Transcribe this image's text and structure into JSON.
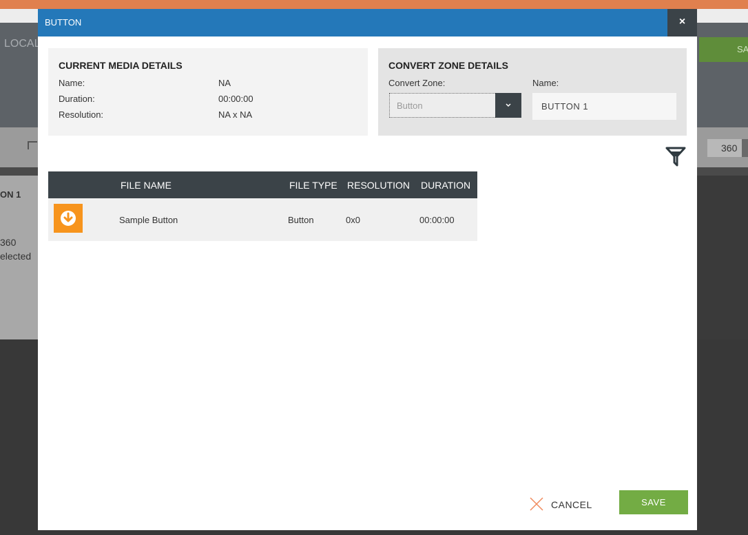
{
  "background": {
    "local_label": "LOCAL",
    "save_label": "SA",
    "zoom_value": "360",
    "panel_title": "ON 1",
    "panel_value": "360",
    "panel_selected": "elected"
  },
  "modal": {
    "title": "BUTTON",
    "close_icon": "×"
  },
  "media_details": {
    "heading": "CURRENT MEDIA DETAILS",
    "rows": [
      {
        "label": "Name:",
        "value": "NA"
      },
      {
        "label": "Duration:",
        "value": "00:00:00"
      },
      {
        "label": "Resolution:",
        "value": "NA x NA"
      }
    ]
  },
  "zone_details": {
    "heading": "CONVERT ZONE DETAILS",
    "convert_zone_label": "Convert Zone:",
    "convert_zone_value": "Button",
    "name_label": "Name:",
    "name_value": "BUTTON 1"
  },
  "table": {
    "columns": [
      "FILE NAME",
      "FILE TYPE",
      "RESOLUTION",
      "DURATION"
    ],
    "rows": [
      {
        "file_name": "Sample Button",
        "file_type": "Button",
        "resolution": "0x0",
        "duration": "00:00:00"
      }
    ]
  },
  "footer": {
    "cancel_label": "CANCEL",
    "save_label": "SAVE"
  },
  "colors": {
    "header_blue": "#2478b9",
    "accent_orange": "#f7941d",
    "save_green": "#73ac44",
    "dark": "#3b4348"
  }
}
